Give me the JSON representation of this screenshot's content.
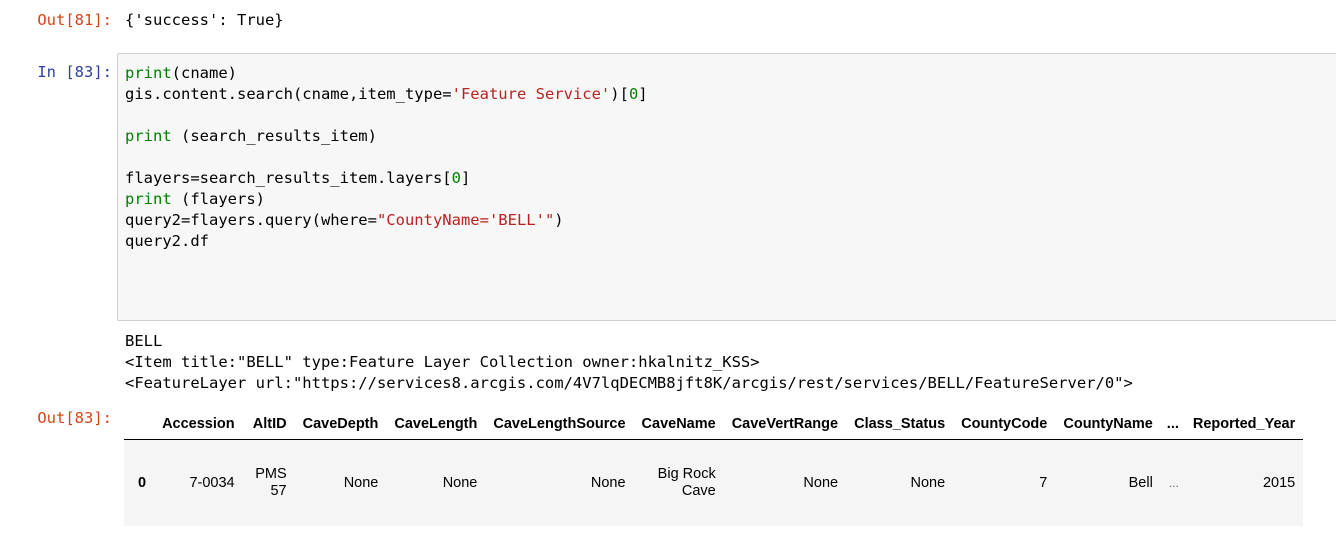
{
  "cells": {
    "out81": {
      "prompt": "Out[81]:",
      "text": "{'success': True}"
    },
    "in83": {
      "prompt": "In [83]:"
    },
    "out83": {
      "prompt": "Out[83]:",
      "stream_lines": [
        "BELL",
        "<Item title:\"BELL\" type:Feature Layer Collection owner:hkalnitz_KSS>",
        "<FeatureLayer url:\"https://services8.arcgis.com/4V7lqDECMB8jft8K/arcgis/rest/services/BELL/FeatureServer/0\">"
      ]
    }
  },
  "code_lines": [
    [
      {
        "t": "kw",
        "v": "print"
      },
      {
        "t": "",
        "v": "(cname)"
      }
    ],
    [
      {
        "t": "",
        "v": "gis.content.search(cname,item_type="
      },
      {
        "t": "str",
        "v": "'Feature Service'"
      },
      {
        "t": "",
        "v": ")["
      },
      {
        "t": "num",
        "v": "0"
      },
      {
        "t": "",
        "v": "]"
      }
    ],
    [],
    [
      {
        "t": "kw",
        "v": "print"
      },
      {
        "t": "",
        "v": " (search_results_item)"
      }
    ],
    [],
    [
      {
        "t": "",
        "v": "flayers=search_results_item.layers["
      },
      {
        "t": "num",
        "v": "0"
      },
      {
        "t": "",
        "v": "]"
      }
    ],
    [
      {
        "t": "kw",
        "v": "print"
      },
      {
        "t": "",
        "v": " (flayers)"
      }
    ],
    [
      {
        "t": "",
        "v": "query2=flayers.query(where="
      },
      {
        "t": "str",
        "v": "\"CountyName='BELL'\""
      },
      {
        "t": "",
        "v": ")"
      }
    ],
    [
      {
        "t": "",
        "v": "query2.df"
      }
    ]
  ],
  "dataframe": {
    "columns": [
      "",
      "Accession",
      "AltID",
      "CaveDepth",
      "CaveLength",
      "CaveLengthSource",
      "CaveName",
      "CaveVertRange",
      "Class_Status",
      "CountyCode",
      "CountyName",
      "...",
      "Reported_Year"
    ],
    "rows": [
      [
        "0",
        "7-0034",
        "PMS 57",
        "None",
        "None",
        "None",
        "Big Rock Cave",
        "None",
        "None",
        "7",
        "Bell",
        "...",
        "2015"
      ]
    ]
  }
}
